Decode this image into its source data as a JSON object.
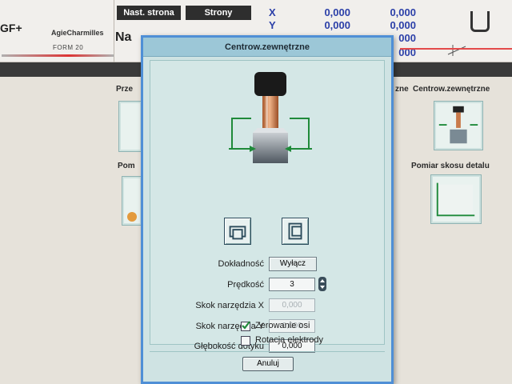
{
  "header": {
    "logo": "GF+",
    "brand": "AgieCharmilles",
    "form_code": "FORM 20",
    "next_page_label": "Nast. strona",
    "pages_label": "Strony",
    "page_title_partial": "Na",
    "coordinates": [
      {
        "axis": "X",
        "value1": "0,000",
        "value2": "0,000"
      },
      {
        "axis": "Y",
        "value1": "0,000",
        "value2": "0,000"
      }
    ],
    "partial_values": [
      "000",
      "000"
    ]
  },
  "background": {
    "left_label_1": "Prze",
    "left_label_2": "Pom",
    "right_partial_label": "zne",
    "card_1_label": "Centrow.zewnętrzne",
    "card_2_label": "Pomiar skosu detalu"
  },
  "dialog": {
    "title": "Centrow.zewnętrzne",
    "fields": {
      "accuracy": {
        "label": "Dokładność",
        "value": "Wyłącz"
      },
      "speed": {
        "label": "Prędkość",
        "value": "3"
      },
      "step_x": {
        "label": "Skok narzędzia X",
        "value": "0,000"
      },
      "step_y": {
        "label": "Skok narzędzia Y",
        "value": "0,000"
      },
      "depth": {
        "label": "Głębokość dotyku",
        "value": "0,000"
      }
    },
    "checkboxes": {
      "zeroing": {
        "label": "Zerowanie osi",
        "checked": true
      },
      "rotation": {
        "label": "Rotacja elektrody",
        "checked": false
      }
    },
    "cancel_label": "Anuluj"
  },
  "colors": {
    "accent": "#4f8fd6",
    "dialog_bg": "#cfe3e3",
    "coord_text": "#2b3fa8",
    "arrow_green": "#1f8a3a"
  },
  "icons": [
    "electrode-illustration",
    "mode-outline-icon",
    "mode-inner-icon",
    "checkmark-icon",
    "u-shape-icon",
    "axes-icon"
  ]
}
